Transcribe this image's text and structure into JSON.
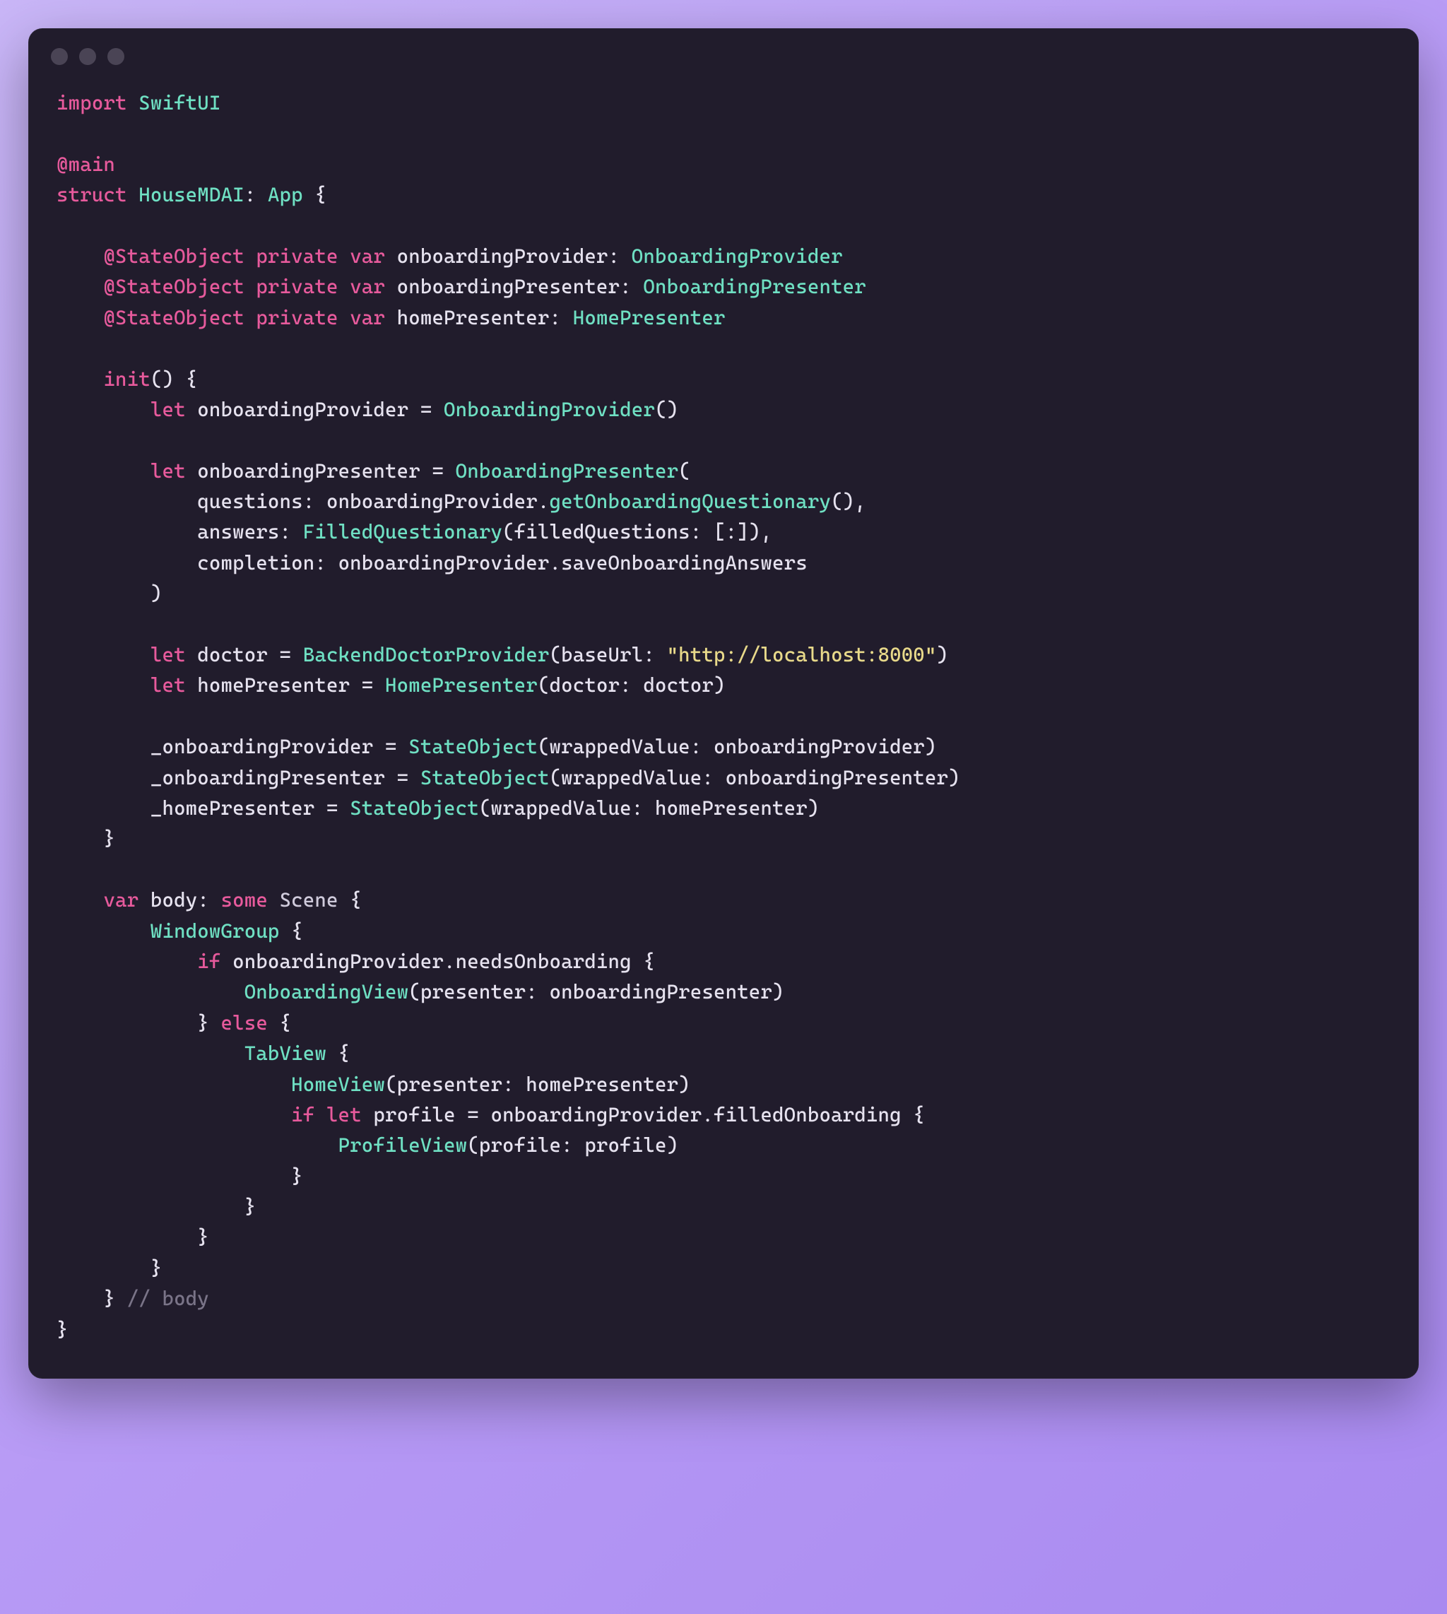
{
  "colors": {
    "bg_window": "#211c2c",
    "bg_page_grad_start": "#c9b6f7",
    "bg_page_grad_end": "#a98af0",
    "token_keyword": "#e75a9c",
    "token_type": "#6fe0c3",
    "token_string": "#e8d98a",
    "token_comment": "#7a7488",
    "token_default": "#e6e2ef"
  },
  "titlebar": {
    "traffic_lights": 3
  },
  "code": {
    "import_kw": "import",
    "import_module": "SwiftUI",
    "main_attr": "@main",
    "struct_kw": "struct",
    "struct_name": "HouseMDAI",
    "app_protocol": "App",
    "state_object_attr": "@StateObject",
    "private_kw": "private",
    "var_kw": "var",
    "let_kw": "let",
    "if_kw": "if",
    "else_kw": "else",
    "some_kw": "some",
    "props": {
      "p1_name": "onboardingProvider",
      "p1_type": "OnboardingProvider",
      "p2_name": "onboardingPresenter",
      "p2_type": "OnboardingPresenter",
      "p3_name": "homePresenter",
      "p3_type": "HomePresenter"
    },
    "init_kw": "init",
    "init_body": {
      "l1_var": "onboardingProvider",
      "l1_ctor": "OnboardingProvider",
      "l2_var": "onboardingPresenter",
      "l2_ctor": "OnboardingPresenter",
      "l2_arg1_label": "questions",
      "l2_arg1_expr_recv": "onboardingProvider",
      "l2_arg1_expr_call": "getOnboardingQuestionary",
      "l2_arg2_label": "answers",
      "l2_arg2_ctor": "FilledQuestionary",
      "l2_arg2_inner_label": "filledQuestions",
      "l2_arg3_label": "completion",
      "l2_arg3_recv": "onboardingProvider",
      "l2_arg3_member": "saveOnboardingAnswers",
      "l3_var": "doctor",
      "l3_ctor": "BackendDoctorProvider",
      "l3_arg_label": "baseUrl",
      "l3_arg_string": "\"http://localhost:8000\"",
      "l4_var": "homePresenter",
      "l4_ctor": "HomePresenter",
      "l4_arg_label": "doctor",
      "l4_arg_val": "doctor",
      "assign1_lhs": "_onboardingProvider",
      "assign_ctor": "StateObject",
      "assign_wrappedLabel": "wrappedValue",
      "assign1_rhs": "onboardingProvider",
      "assign2_lhs": "_onboardingPresenter",
      "assign2_rhs": "onboardingPresenter",
      "assign3_lhs": "_homePresenter",
      "assign3_rhs": "homePresenter"
    },
    "body_name": "body",
    "body_type": "Scene",
    "window_group": "WindowGroup",
    "cond_recv": "onboardingProvider",
    "cond_member": "needsOnboarding",
    "onboarding_view": "OnboardingView",
    "onboarding_view_label": "presenter",
    "onboarding_view_arg": "onboardingPresenter",
    "tab_view": "TabView",
    "home_view": "HomeView",
    "home_view_label": "presenter",
    "home_view_arg": "homePresenter",
    "iflet_var": "profile",
    "iflet_recv": "onboardingProvider",
    "iflet_member": "filledOnboarding",
    "profile_view": "ProfileView",
    "profile_view_label": "profile",
    "profile_view_arg": "profile",
    "body_comment": "// body"
  }
}
